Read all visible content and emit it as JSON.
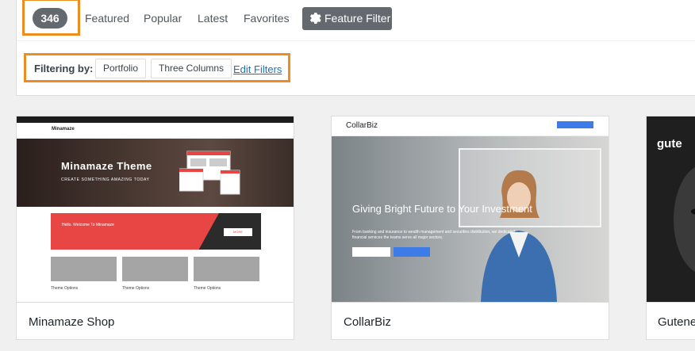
{
  "toolbar": {
    "count": "346",
    "tabs": [
      "Featured",
      "Popular",
      "Latest",
      "Favorites"
    ],
    "feature_filter_label": "Feature Filter"
  },
  "filter": {
    "label": "Filtering by:",
    "chips": [
      "Portfolio",
      "Three Columns"
    ],
    "edit_link": "Edit Filters"
  },
  "themes": [
    {
      "name": "Minamaze Shop",
      "preview": {
        "logo": "Minamaze",
        "hero_title": "Minamaze Theme",
        "hero_subtitle": "CREATE SOMETHING AMAZING TODAY",
        "banner_text": "Hello. Welcome To Minamaze",
        "banner_button": "MORE",
        "box_labels": [
          "Theme Options",
          "Theme Options",
          "Theme Options"
        ]
      }
    },
    {
      "name": "CollarBiz",
      "preview": {
        "logo": "CollarBiz",
        "hero_title": "Giving Bright Future to Your Investment",
        "hero_text": "From banking and insurance to wealth management and securities distribution, we dedicated financial services the teams serve all major sectors."
      }
    },
    {
      "name": "Gutene",
      "preview": {
        "logo": "gute"
      }
    }
  ],
  "colors": {
    "highlight": "#ed8c21",
    "count_badge": "#646970",
    "link": "#2271b1"
  }
}
